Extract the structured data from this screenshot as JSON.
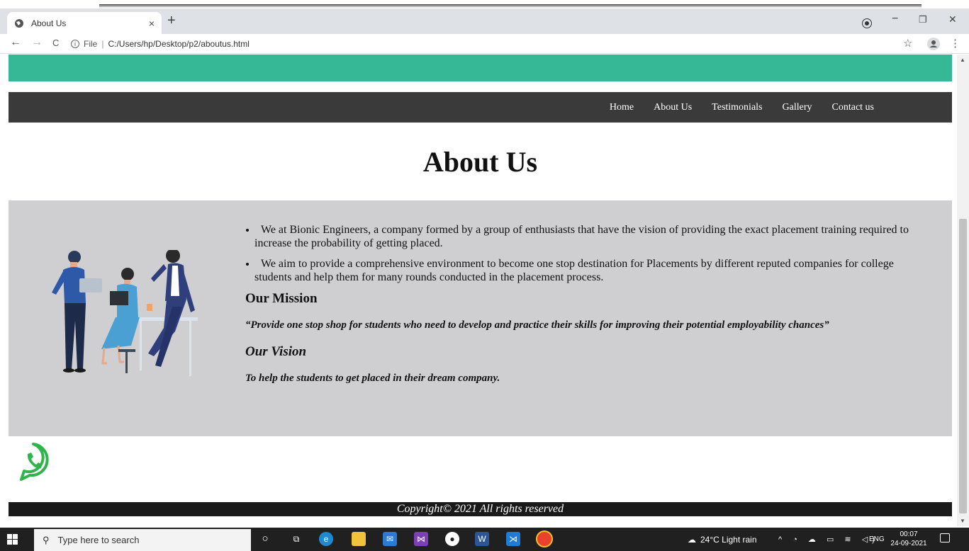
{
  "browser": {
    "tab_title": "About Us",
    "tab_close": "×",
    "new_tab": "+",
    "url_scheme": "File",
    "url_separator": "|",
    "url_path": "C:/Users/hp/Desktop/p2/aboutus.html",
    "back": "←",
    "forward": "→",
    "reload": "C",
    "minimize": "−",
    "restore": "❐",
    "close": "✕",
    "bookmark": "☆",
    "menu": "⋮"
  },
  "site": {
    "nav": [
      "Home",
      "About Us",
      "Testimonials",
      "Gallery",
      "Contact us"
    ],
    "heading": "About Us",
    "bullets": [
      "We at Bionic Engineers, a company formed by a group of enthusiasts that have the vision of providing the exact placement training required to increase the probability of getting placed.",
      "We aim to provide a comprehensive environment to become one stop destination for Placements by different reputed companies for college students and help them for many rounds conducted in the placement process."
    ],
    "mission_heading": "Our Mission",
    "mission_text": "“Provide one stop shop for students who need to develop and practice their skills for improving their potential employability chances”",
    "vision_heading": "Our Vision",
    "vision_text": "To help the students to get placed in their dream company.",
    "footer": "Copyright© 2021 All rights reserved",
    "colors": {
      "teal_band": "#36b795",
      "navbar": "#3a3a3a",
      "content_bg": "#cfcfd1",
      "footer": "#1a1a1a",
      "whatsapp": "#2fb54a"
    }
  },
  "taskbar": {
    "search_placeholder": "Type here to search",
    "weather": "24°C  Light rain",
    "language": "ENG",
    "time": "00:07",
    "date": "24-09-2021"
  }
}
